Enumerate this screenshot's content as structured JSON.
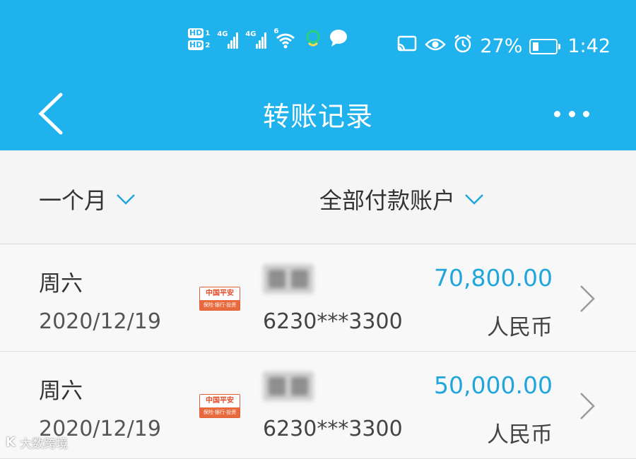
{
  "status_bar": {
    "sim_labels": [
      "1",
      "2"
    ],
    "hd_label": "HD",
    "signal_labels": [
      "4G",
      "4G"
    ],
    "wifi_label": "6",
    "battery_percent": "27%",
    "battery_level": 0.27,
    "time": "1:42"
  },
  "header": {
    "title": "转账记录",
    "background": "#1fb2ec"
  },
  "filters": {
    "period": "一个月",
    "account": "全部付款账户"
  },
  "records": [
    {
      "weekday": "周六",
      "date": "2020/12/19",
      "bank_logo_text": "中国平安",
      "bank_logo_sub": "保险·银行·投资",
      "account": "6230***3300",
      "amount": "70,800.00",
      "currency": "人民币"
    },
    {
      "weekday": "周六",
      "date": "2020/12/19",
      "bank_logo_text": "中国平安",
      "bank_logo_sub": "保险·银行·投资",
      "account": "6230***3300",
      "amount": "50,000.00",
      "currency": "人民币"
    }
  ],
  "watermark": {
    "text": "大数跨境",
    "logo_text": "K"
  },
  "colors": {
    "accent": "#20a6dc",
    "header": "#1fb2ec",
    "bank_logo": "#e24b26"
  }
}
